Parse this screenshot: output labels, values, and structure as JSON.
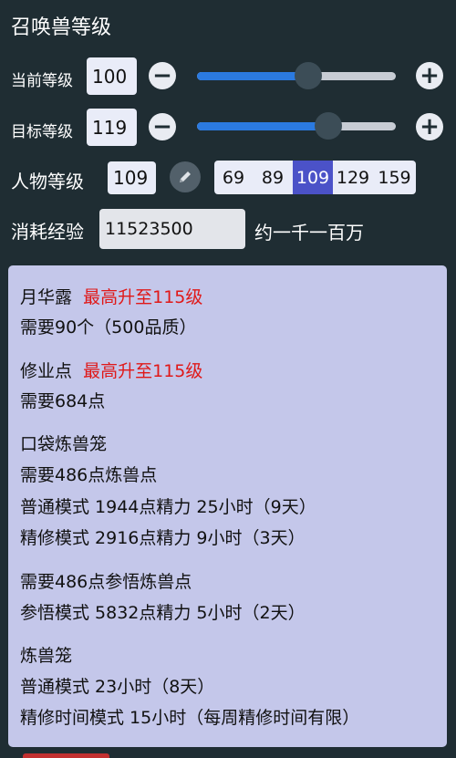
{
  "title": "召唤兽等级",
  "current": {
    "label": "当前等级",
    "value": "100",
    "slider_fraction": 0.56
  },
  "target": {
    "label": "目标等级",
    "value": "119",
    "slider_fraction": 0.66
  },
  "minus_symbol": "−",
  "plus_symbol": "+",
  "character": {
    "label": "人物等级",
    "value": "109",
    "options": [
      "69",
      "89",
      "109",
      "129",
      "159"
    ],
    "selected_index": 2
  },
  "exp": {
    "label": "消耗经验",
    "value": "11523500",
    "approx": "约一千一百万"
  },
  "panel": {
    "yuehualu": {
      "name": "月华露",
      "warning": "最高升至115级",
      "need": "需要90个（500品质）"
    },
    "xiuye": {
      "name": "修业点",
      "warning": "最高升至115级",
      "need": "需要684点"
    },
    "pocket_cage": {
      "name": "口袋炼兽笼",
      "need": "需要486点炼兽点",
      "normal": "普通模式 1944点精力 25小时（9天）",
      "refine": "精修模式 2916点精力 9小时（3天）",
      "need2": "需要486点参悟炼兽点",
      "insight": "参悟模式 5832点精力 5小时（2天）"
    },
    "cage": {
      "name": "炼兽笼",
      "normal": "普通模式 23小时（8天）",
      "refine": "精修时间模式 15小时（每周精修时间有限）"
    }
  },
  "icons": {
    "pencil": "pencil-icon",
    "minus": "minus-icon",
    "plus": "plus-icon"
  },
  "colors": {
    "accent": "#2b7ae0",
    "selected": "#4b52c8",
    "warning": "#e01818",
    "background": "#1f2d33",
    "panel": "#c4c7ea"
  }
}
